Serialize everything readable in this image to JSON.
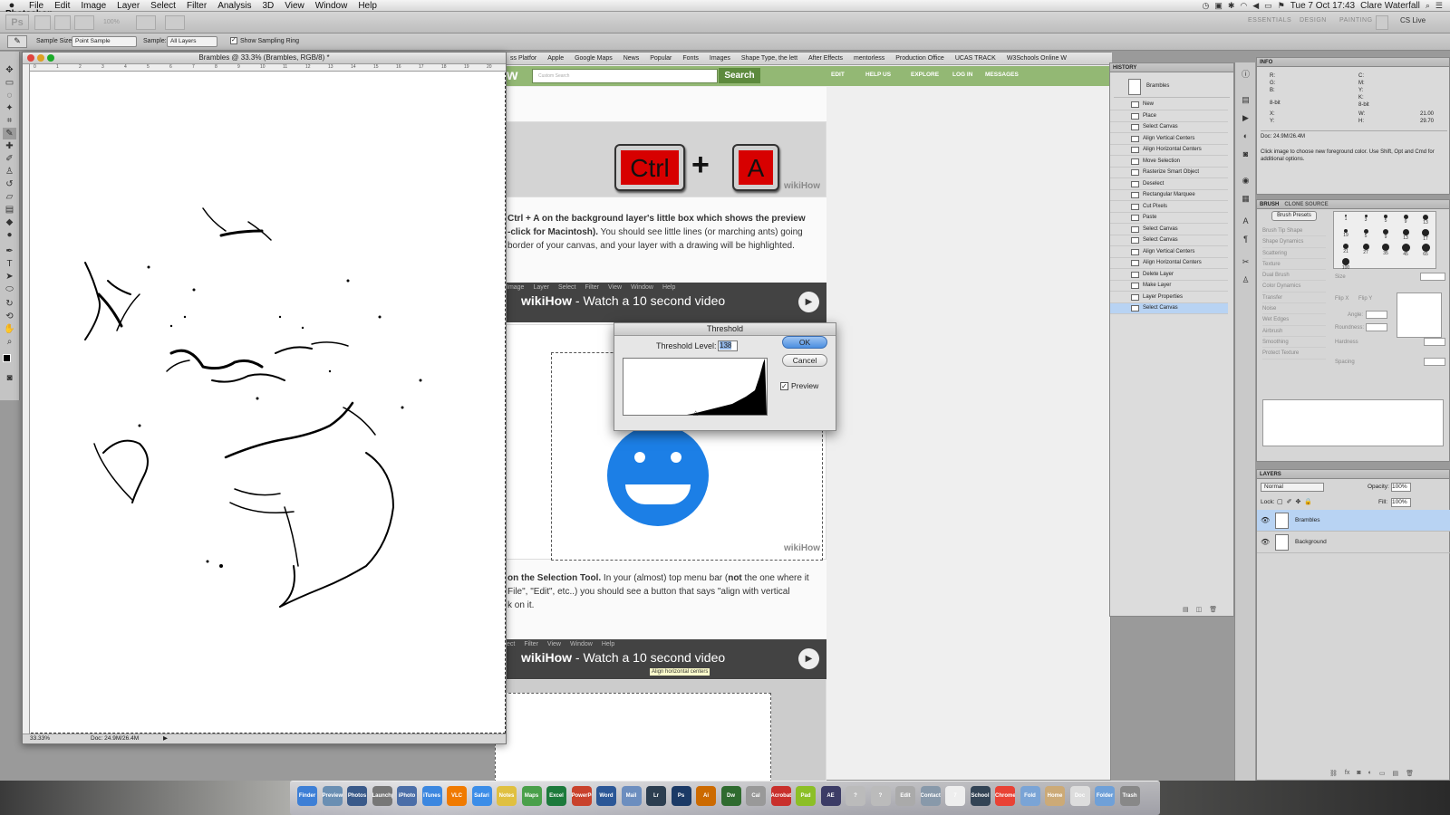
{
  "menubar": {
    "apple": "",
    "items": [
      "Photoshop",
      "File",
      "Edit",
      "Image",
      "Layer",
      "Select",
      "Filter",
      "Analysis",
      "3D",
      "View",
      "Window",
      "Help"
    ],
    "clock": "Tue 7 Oct  17:43",
    "user": "Clare Waterfall"
  },
  "appbar": {
    "ps_logo": "Ps",
    "zoom": "100%",
    "workspaces": [
      "ESSENTIALS",
      "DESIGN",
      "PAINTING"
    ],
    "cs_live": "CS Live"
  },
  "options": {
    "sample_size_label": "Sample Size:",
    "sample_size_value": "Point Sample",
    "sample_label": "Sample:",
    "sample_value": "All Layers",
    "ring_label": "Show Sampling Ring"
  },
  "document": {
    "title": "Brambles @ 33.3% (Brambles, RGB/8) *",
    "zoom": "33.33%",
    "doc_size": "Doc: 24.9M/26.4M",
    "ruler_ticks": [
      "0",
      "1",
      "2",
      "3",
      "4",
      "5",
      "6",
      "7",
      "8",
      "9",
      "10",
      "11",
      "12",
      "13",
      "14",
      "15",
      "16",
      "17",
      "18",
      "19",
      "20"
    ]
  },
  "browser": {
    "bookmarks": [
      "ss Platfor",
      "Apple",
      "Google Maps",
      "News",
      "Popular",
      "Fonts",
      "Images",
      "Shape Type, the lett",
      "After Effects",
      "mentorless",
      "Production Office",
      "UCAS TRACK",
      "W3Schools Online W"
    ],
    "logo": "w",
    "search_placeholder": "Custom Search",
    "search_button": "Search",
    "nav": [
      "EDIT",
      "HELP US",
      "EXPLORE",
      "LOG IN",
      "MESSAGES"
    ],
    "key1": "Ctrl",
    "plus": "+",
    "key2": "A",
    "watermark": "wikiHow",
    "para1_bold": "Ctrl + A on the background layer's little box which shows the preview",
    "para1_b2": "-click for Macintosh).",
    "para1_rest": " You should see little lines (or marching ants) going",
    "para1_line3": "border of your canvas, and your layer with a drawing will be highlighted.",
    "video_brand": "wikiHow",
    "video_text": " - Watch a 10 second video",
    "video_menu": [
      "Image",
      "Layer",
      "Select",
      "Filter",
      "View",
      "Window",
      "Help"
    ],
    "para2_bold": "on the Selection Tool.",
    "para2_rest": " In your (almost) top menu bar (",
    "para2_not": "not",
    "para2_rest2": " the one where it",
    "para2_line2": "File\", \"Edit\", etc..) you should see a button that says \"align with vertical",
    "para2_line3": "k on it.",
    "video2_menu": [
      "ect",
      "Filter",
      "View",
      "Window",
      "Help"
    ],
    "tooltip": "Align horizontal centers"
  },
  "threshold": {
    "title": "Threshold",
    "level_label": "Threshold Level:",
    "level_value": "138",
    "ok": "OK",
    "cancel": "Cancel",
    "preview": "Preview"
  },
  "history": {
    "title": "HISTORY",
    "snapshot": "Brambles",
    "items": [
      "New",
      "Place",
      "Select Canvas",
      "Align Vertical Centers",
      "Align Horizontal Centers",
      "Move Selection",
      "Rasterize Smart Object",
      "Deselect",
      "Rectangular Marquee",
      "Cut Pixels",
      "Paste",
      "Select Canvas",
      "Select Canvas",
      "Align Vertical Centers",
      "Align Horizontal Centers",
      "Delete Layer",
      "Make Layer",
      "Layer Properties",
      "Select Canvas"
    ],
    "selected_index": 18
  },
  "info": {
    "title": "INFO",
    "r": "R:",
    "g": "G:",
    "b": "B:",
    "c": "C:",
    "m": "M:",
    "y": "Y:",
    "k": "K:",
    "bit1": "8-bit",
    "bit2": "8-bit",
    "x": "X:",
    "y2": "Y:",
    "w": "W:",
    "h": "H:",
    "w_val": "21.00",
    "h_val": "29.70",
    "doc": "Doc: 24.9M/26.4M",
    "hint": "Click image to choose new foreground color.  Use Shift, Opt and Cmd for additional options."
  },
  "brush": {
    "tabs": [
      "BRUSH",
      "CLONE SOURCE"
    ],
    "presets_button": "Brush Presets",
    "options": [
      "Brush Tip Shape",
      "Shape Dynamics",
      "Scattering",
      "Texture",
      "Dual Brush",
      "Color Dynamics",
      "Transfer",
      "Noise",
      "Wet Edges",
      "Airbrush",
      "Smoothing",
      "Protect Texture"
    ],
    "sizes": [
      "1",
      "3",
      "5",
      "9",
      "13",
      "19",
      "5",
      "9",
      "13",
      "17",
      "21",
      "27",
      "35",
      "45",
      "65",
      "100"
    ],
    "size_label": "Size",
    "flipx": "Flip X",
    "flipy": "Flip Y",
    "angle": "Angle:",
    "roundness": "Roundness:",
    "hardness": "Hardness",
    "spacing": "Spacing"
  },
  "layers": {
    "title": "LAYERS",
    "blend": "Normal",
    "opacity_label": "Opacity:",
    "opacity": "100%",
    "lock_label": "Lock:",
    "fill_label": "Fill:",
    "fill": "100%",
    "items": [
      {
        "name": "Brambles",
        "selected": true
      },
      {
        "name": "Background",
        "selected": false
      }
    ]
  },
  "dock": {
    "apps": [
      "Finder",
      "Preview",
      "Photos",
      "Launchpad",
      "iPhoto",
      "iTunes",
      "VLC",
      "Safari",
      "Notes",
      "Maps",
      "Excel",
      "PowerPoint",
      "Word",
      "Mail",
      "Lr",
      "Ps",
      "Ai",
      "Dw",
      "Cal",
      "Acrobat",
      "Pad",
      "AE",
      "?",
      "?",
      "Edit",
      "Contacts",
      "7",
      "School",
      "Chrome",
      "Fold",
      "Home",
      "Doc",
      "Folder",
      "Trash"
    ]
  }
}
